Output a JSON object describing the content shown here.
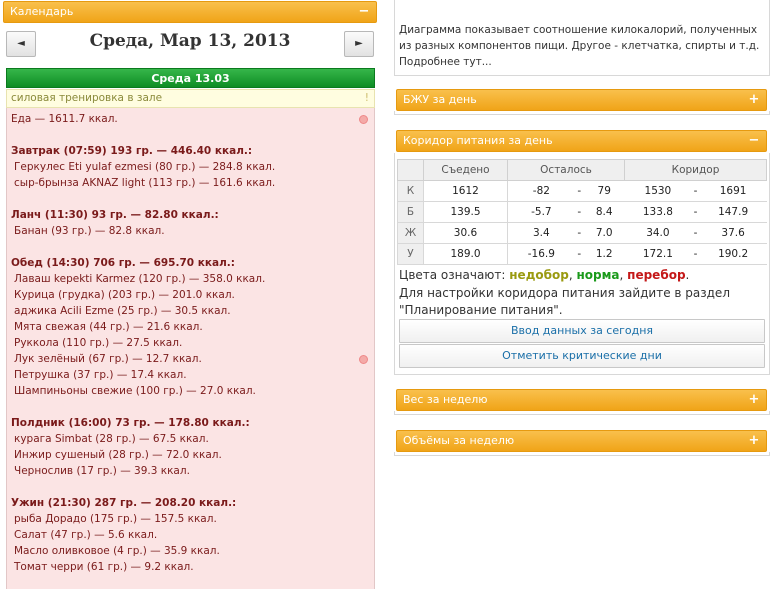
{
  "calendar": {
    "title": "Календарь",
    "collapse_icon": "minus-icon",
    "date_title": "Среда, Мар 13, 2013",
    "prev_label": "◄",
    "next_label": "►",
    "day_label": "Среда 13.03",
    "note": "силовая тренировка в зале",
    "note_mark": "!"
  },
  "food": {
    "total": "Еда — 1611.7 ккал.",
    "meals": [
      {
        "header": "Завтрак (07:59) 193 гр. — 446.40 ккал.:",
        "items": [
          "Геркулес Eti yulaf ezmesi (80 гр.) — 284.8 ккал.",
          "сыр-брынза AKNAZ light (113 гр.) — 161.6 ккал."
        ]
      },
      {
        "header": "Ланч (11:30) 93 гр. — 82.80 ккал.:",
        "items": [
          "Банан (93 гр.) — 82.8 ккал."
        ]
      },
      {
        "header": "Обед (14:30) 706 гр. — 695.70 ккал.:",
        "items": [
          "Лаваш kepekti Karmez (120 гр.) — 358.0 ккал.",
          "Курица (грудка) (203 гр.) — 201.0 ккал.",
          "аджика Acili Ezme (25 гр.) — 30.5 ккал.",
          "Мята свежая (44 гр.) — 21.6 ккал.",
          "Руккола (110 гр.) — 27.5 ккал.",
          "Лук зелёный (67 гр.) — 12.7 ккал.",
          "Петрушка (37 гр.) — 17.4 ккал.",
          "Шампиньоны свежие (100 гр.) — 27.0 ккал."
        ]
      },
      {
        "header": "Полдник (16:00) 73 гр. — 178.80 ккал.:",
        "items": [
          "курага Simbat (28 гр.) — 67.5 ккал.",
          "Инжир сушеный (28 гр.) — 72.0 ккал.",
          "Чернослив (17 гр.) — 39.3 ккал."
        ]
      },
      {
        "header": "Ужин (21:30) 287 гр. — 208.20 ккал.:",
        "items": [
          "рыба Дорадо (175 гр.) — 157.5 ккал.",
          "Салат (47 гр.) — 5.6 ккал.",
          "Масло оливковое (4 гр.) — 35.9 ккал.",
          "Томат черри (61 гр.) — 9.2 ккал."
        ]
      }
    ]
  },
  "pie": {
    "description": "Диаграмма показывает соотношение килокалорий, полученных из разных компонентов пищи. Другое - клетчатка, спирты и т.д.",
    "more_link": "Подробнее тут..."
  },
  "panels": {
    "bju": "БЖУ за день",
    "corridor": "Коридор питания за день",
    "weight": "Вес за неделю",
    "volumes": "Объёмы за неделю",
    "expand_icon": "plus-icon",
    "collapse_icon": "minus-icon"
  },
  "corridor": {
    "headers": [
      "Съедено",
      "Осталось",
      "Коридор"
    ],
    "rows": [
      {
        "label": "К",
        "eaten": "1612",
        "eaten_class": "c-green",
        "left_min": "-82",
        "dash": "-",
        "left_max": "79",
        "corr_min": "1530",
        "corr_max": "1691"
      },
      {
        "label": "Б",
        "eaten": "139.5",
        "eaten_class": "c-green",
        "left_min": "-5.7",
        "dash": "-",
        "left_max": "8.4",
        "corr_min": "133.8",
        "corr_max": "147.9"
      },
      {
        "label": "Ж",
        "eaten": "30.6",
        "eaten_class": "c-olive",
        "left_min": "3.4",
        "dash": "-",
        "left_max": "7.0",
        "corr_min": "34.0",
        "corr_max": "37.6"
      },
      {
        "label": "У",
        "eaten": "189.0",
        "eaten_class": "c-green",
        "left_min": "-16.9",
        "dash": "-",
        "left_max": "1.2",
        "corr_min": "172.1",
        "corr_max": "190.2"
      }
    ],
    "legend_prefix": "Цвета означают:",
    "legend_under": "недобор",
    "legend_norm": "норма",
    "legend_over": "перебор",
    "settings_text": "Для настройки коридора питания зайдите в раздел \"Планирование питания\".",
    "btn_today": "Ввод данных за сегодня",
    "btn_critical": "Отметить критические дни"
  },
  "colors": {
    "orange": "#f0a418",
    "green_header": "#1f9d33",
    "food_bg": "#fbe4e4",
    "link": "#1a6fa8"
  }
}
